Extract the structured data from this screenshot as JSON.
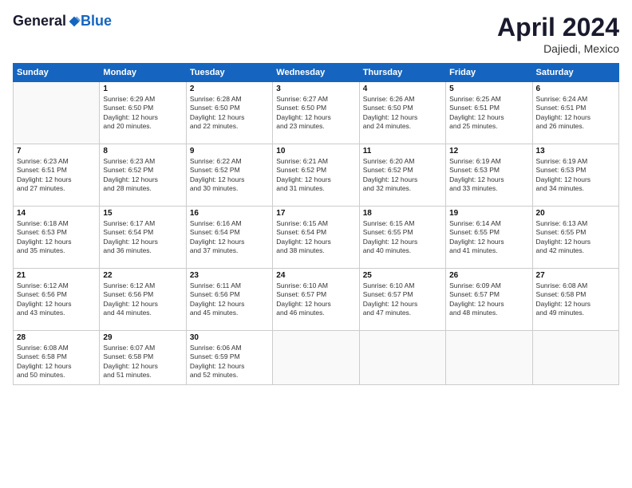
{
  "logo": {
    "general": "General",
    "blue": "Blue"
  },
  "title": "April 2024",
  "subtitle": "Dajiedi, Mexico",
  "days_header": [
    "Sunday",
    "Monday",
    "Tuesday",
    "Wednesday",
    "Thursday",
    "Friday",
    "Saturday"
  ],
  "weeks": [
    [
      {
        "num": "",
        "info": ""
      },
      {
        "num": "1",
        "info": "Sunrise: 6:29 AM\nSunset: 6:50 PM\nDaylight: 12 hours\nand 20 minutes."
      },
      {
        "num": "2",
        "info": "Sunrise: 6:28 AM\nSunset: 6:50 PM\nDaylight: 12 hours\nand 22 minutes."
      },
      {
        "num": "3",
        "info": "Sunrise: 6:27 AM\nSunset: 6:50 PM\nDaylight: 12 hours\nand 23 minutes."
      },
      {
        "num": "4",
        "info": "Sunrise: 6:26 AM\nSunset: 6:50 PM\nDaylight: 12 hours\nand 24 minutes."
      },
      {
        "num": "5",
        "info": "Sunrise: 6:25 AM\nSunset: 6:51 PM\nDaylight: 12 hours\nand 25 minutes."
      },
      {
        "num": "6",
        "info": "Sunrise: 6:24 AM\nSunset: 6:51 PM\nDaylight: 12 hours\nand 26 minutes."
      }
    ],
    [
      {
        "num": "7",
        "info": "Sunrise: 6:23 AM\nSunset: 6:51 PM\nDaylight: 12 hours\nand 27 minutes."
      },
      {
        "num": "8",
        "info": "Sunrise: 6:23 AM\nSunset: 6:52 PM\nDaylight: 12 hours\nand 28 minutes."
      },
      {
        "num": "9",
        "info": "Sunrise: 6:22 AM\nSunset: 6:52 PM\nDaylight: 12 hours\nand 30 minutes."
      },
      {
        "num": "10",
        "info": "Sunrise: 6:21 AM\nSunset: 6:52 PM\nDaylight: 12 hours\nand 31 minutes."
      },
      {
        "num": "11",
        "info": "Sunrise: 6:20 AM\nSunset: 6:52 PM\nDaylight: 12 hours\nand 32 minutes."
      },
      {
        "num": "12",
        "info": "Sunrise: 6:19 AM\nSunset: 6:53 PM\nDaylight: 12 hours\nand 33 minutes."
      },
      {
        "num": "13",
        "info": "Sunrise: 6:19 AM\nSunset: 6:53 PM\nDaylight: 12 hours\nand 34 minutes."
      }
    ],
    [
      {
        "num": "14",
        "info": "Sunrise: 6:18 AM\nSunset: 6:53 PM\nDaylight: 12 hours\nand 35 minutes."
      },
      {
        "num": "15",
        "info": "Sunrise: 6:17 AM\nSunset: 6:54 PM\nDaylight: 12 hours\nand 36 minutes."
      },
      {
        "num": "16",
        "info": "Sunrise: 6:16 AM\nSunset: 6:54 PM\nDaylight: 12 hours\nand 37 minutes."
      },
      {
        "num": "17",
        "info": "Sunrise: 6:15 AM\nSunset: 6:54 PM\nDaylight: 12 hours\nand 38 minutes."
      },
      {
        "num": "18",
        "info": "Sunrise: 6:15 AM\nSunset: 6:55 PM\nDaylight: 12 hours\nand 40 minutes."
      },
      {
        "num": "19",
        "info": "Sunrise: 6:14 AM\nSunset: 6:55 PM\nDaylight: 12 hours\nand 41 minutes."
      },
      {
        "num": "20",
        "info": "Sunrise: 6:13 AM\nSunset: 6:55 PM\nDaylight: 12 hours\nand 42 minutes."
      }
    ],
    [
      {
        "num": "21",
        "info": "Sunrise: 6:12 AM\nSunset: 6:56 PM\nDaylight: 12 hours\nand 43 minutes."
      },
      {
        "num": "22",
        "info": "Sunrise: 6:12 AM\nSunset: 6:56 PM\nDaylight: 12 hours\nand 44 minutes."
      },
      {
        "num": "23",
        "info": "Sunrise: 6:11 AM\nSunset: 6:56 PM\nDaylight: 12 hours\nand 45 minutes."
      },
      {
        "num": "24",
        "info": "Sunrise: 6:10 AM\nSunset: 6:57 PM\nDaylight: 12 hours\nand 46 minutes."
      },
      {
        "num": "25",
        "info": "Sunrise: 6:10 AM\nSunset: 6:57 PM\nDaylight: 12 hours\nand 47 minutes."
      },
      {
        "num": "26",
        "info": "Sunrise: 6:09 AM\nSunset: 6:57 PM\nDaylight: 12 hours\nand 48 minutes."
      },
      {
        "num": "27",
        "info": "Sunrise: 6:08 AM\nSunset: 6:58 PM\nDaylight: 12 hours\nand 49 minutes."
      }
    ],
    [
      {
        "num": "28",
        "info": "Sunrise: 6:08 AM\nSunset: 6:58 PM\nDaylight: 12 hours\nand 50 minutes."
      },
      {
        "num": "29",
        "info": "Sunrise: 6:07 AM\nSunset: 6:58 PM\nDaylight: 12 hours\nand 51 minutes."
      },
      {
        "num": "30",
        "info": "Sunrise: 6:06 AM\nSunset: 6:59 PM\nDaylight: 12 hours\nand 52 minutes."
      },
      {
        "num": "",
        "info": ""
      },
      {
        "num": "",
        "info": ""
      },
      {
        "num": "",
        "info": ""
      },
      {
        "num": "",
        "info": ""
      }
    ]
  ]
}
